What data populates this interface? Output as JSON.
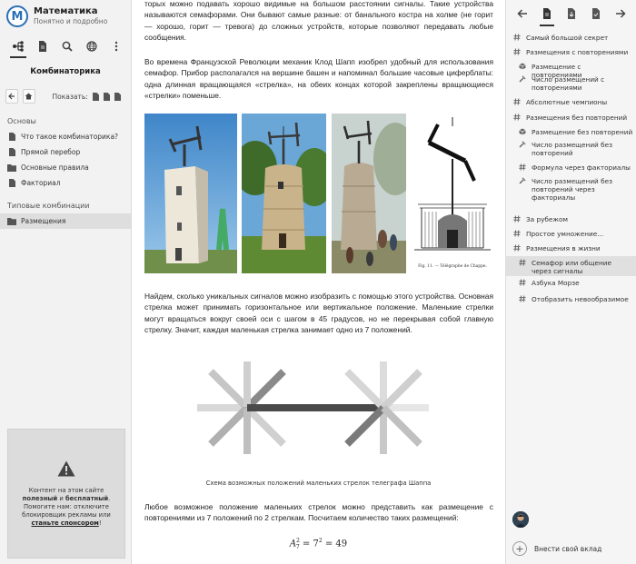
{
  "brand": {
    "logo": "M",
    "title": "Математика",
    "subtitle": "Понятно и подробно"
  },
  "left": {
    "tab_icons": [
      "hierarchy-icon",
      "document-icon",
      "search-icon",
      "globe-icon",
      "more-icon"
    ],
    "section_title": "Комбинаторика",
    "show_label": "Показать:",
    "groups": [
      {
        "title": "Основы",
        "items": [
          {
            "label": "Что такое комбинаторика?",
            "icon": "document-icon"
          },
          {
            "label": "Прямой перебор",
            "icon": "document-icon"
          },
          {
            "label": "Основные правила",
            "icon": "folder-icon"
          },
          {
            "label": "Факториал",
            "icon": "document-icon"
          }
        ]
      },
      {
        "title": "Типовые комбинации",
        "items": [
          {
            "label": "Размещения",
            "icon": "folder-icon",
            "active": true
          }
        ]
      }
    ],
    "ad": {
      "line1": "Контент на этом сайте",
      "bold1": "полезный",
      "and": " и ",
      "bold2": "бесплатный",
      "dot": ".",
      "line2": "Помогите нам: отключите",
      "line3": "блокировщик рекламы или",
      "link": "станьте спонсором",
      "excl": "!"
    }
  },
  "main": {
    "p0": "торых можно подавать хорошо видимые на большом расстоянии сигналы. Такие устройства называются семафорами. Они бывают самые разные: от банального костра на холме (не горит — хорошо, горит — тревога) до сложных устройств, которые позволяют передавать любые сообщения.",
    "p1": "Во времена Французской Революции механик Клод Шапп изобрел удобный для использования семафор. Прибор располагался на вершине башен и напоминал большие часовые циферблаты: одна длинная вращающаяся «стрелка», на обеих концах которой закреплены вращающиеся «стрелки» поменьше.",
    "p2": "Найдем, сколько уникальных сигналов можно изобразить с помощью этого устройства. Основная стрелка может принимать горизонтальное или вертикальное положение. Маленькие стрелки могут вращаться вокруг своей оси с шагом в 45 градусов, но не перекрывая собой главную стрелку. Значит, каждая маленькая стрелка занимает одно из 7 положений.",
    "engraving_caption": "Fig. 11. — Télégraphe de Chappe.",
    "caption": "Схема возможных положений маленьких стрелок телеграфа Шаппа",
    "p3": "Любое возможное положение маленьких стрелок можно представить как размещение с повторениями из 7 положений по 2 стрелкам. Посчитаем количество таких размещений:",
    "formula": {
      "lhs": "A",
      "sub": "7",
      "sup": "2",
      "eq1": " = 7",
      "sup2": "2",
      "eq2": " = 49"
    }
  },
  "right": {
    "tab_icons": [
      "arrow-left-icon",
      "document-icon",
      "download-icon",
      "check-document-icon",
      "arrow-right-icon"
    ],
    "toc": [
      {
        "label": "Самый большой секрет",
        "icon": "hash-icon",
        "level": 0
      },
      {
        "label": "Размещения с повторениями",
        "icon": "hash-icon",
        "level": 0
      },
      {
        "label": "Размещение с повторениями",
        "icon": "cube-icon",
        "level": 1
      },
      {
        "label": "Число размещений с повторениями",
        "icon": "hammer-icon",
        "level": 1
      },
      {
        "label": "Абсолютные чемпионы",
        "icon": "hash-icon",
        "level": 0
      },
      {
        "label": "Размещения без повторений",
        "icon": "hash-icon",
        "level": 0
      },
      {
        "label": "Размещение без повторений",
        "icon": "cube-icon",
        "level": 1
      },
      {
        "label": "Число размещений без повторений",
        "icon": "hammer-icon",
        "level": 1
      },
      {
        "label": "Формула через факториалы",
        "icon": "hash-icon",
        "level": 1
      },
      {
        "label": "Число размещений без повторений через факториалы",
        "icon": "hammer-icon",
        "level": 1
      },
      {
        "label": "За рубежом",
        "icon": "hash-icon",
        "level": 0
      },
      {
        "label": "Простое умножение...",
        "icon": "hash-icon",
        "level": 0
      },
      {
        "label": "Размещения в жизни",
        "icon": "hash-icon",
        "level": 0
      },
      {
        "label": "Семафор или общение через сигналы",
        "icon": "hash-icon",
        "level": 1,
        "active": true
      },
      {
        "label": "Азбука Морзе",
        "icon": "hash-icon",
        "level": 1
      },
      {
        "label": "Отобразить невообразимое",
        "icon": "hash-icon",
        "level": 1
      }
    ],
    "contribute": "Внести свой вклад"
  }
}
